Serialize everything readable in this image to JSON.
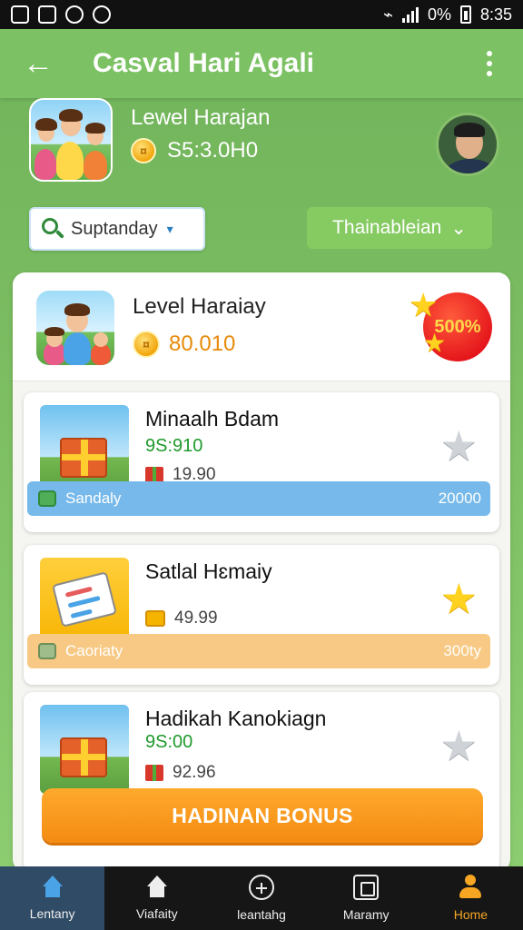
{
  "status_bar": {
    "battery_text": "0%",
    "time": "8:35"
  },
  "app_bar": {
    "title": "Casval Hari Agali"
  },
  "profile": {
    "level_label": "Lewel Harajan",
    "balance": "S5:3.0H0"
  },
  "filters": {
    "search_value": "Suptanday",
    "dropdown_label": "Thainableian"
  },
  "featured": {
    "title": "Level Haraiay",
    "value": "80.010",
    "badge_text": "500%"
  },
  "items": [
    {
      "title": "Minaalh Bdam",
      "price": "9S:910",
      "sub_value": "19.90",
      "bar_label": "Sandaly",
      "bar_value": "20000"
    },
    {
      "title": "Satlal Hɛmaiy",
      "price": "",
      "sub_value": "49.99",
      "bar_label": "Caoriaty",
      "bar_value": "300ty"
    },
    {
      "title": "Hadikah Kanokiagn",
      "price": "9S:00",
      "sub_value": "92.96",
      "bar_label": "",
      "bar_value": ""
    }
  ],
  "cta": {
    "label": "HADINAN BONUS"
  },
  "bottom_nav": [
    {
      "label": "Lentany",
      "icon": "home-icon"
    },
    {
      "label": "Viafaity",
      "icon": "store-icon"
    },
    {
      "label": "leantahg",
      "icon": "plus-circle-icon"
    },
    {
      "label": "Maramy",
      "icon": "box-icon"
    },
    {
      "label": "Home",
      "icon": "user-icon"
    }
  ],
  "colors": {
    "brand_green": "#7cc163",
    "accent_orange": "#f48b12",
    "promo_red": "#e4141a"
  }
}
